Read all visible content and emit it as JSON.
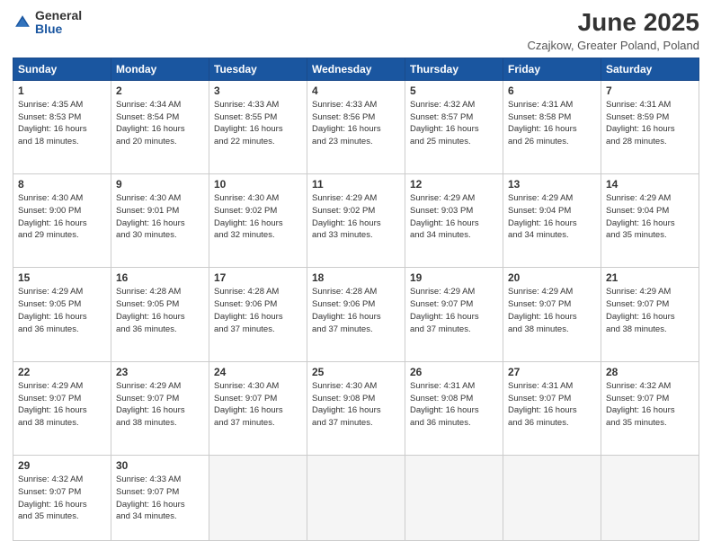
{
  "header": {
    "logo_general": "General",
    "logo_blue": "Blue",
    "month_title": "June 2025",
    "location": "Czajkow, Greater Poland, Poland"
  },
  "days_of_week": [
    "Sunday",
    "Monday",
    "Tuesday",
    "Wednesday",
    "Thursday",
    "Friday",
    "Saturday"
  ],
  "weeks": [
    [
      {
        "day": 1,
        "info": "Sunrise: 4:35 AM\nSunset: 8:53 PM\nDaylight: 16 hours\nand 18 minutes."
      },
      {
        "day": 2,
        "info": "Sunrise: 4:34 AM\nSunset: 8:54 PM\nDaylight: 16 hours\nand 20 minutes."
      },
      {
        "day": 3,
        "info": "Sunrise: 4:33 AM\nSunset: 8:55 PM\nDaylight: 16 hours\nand 22 minutes."
      },
      {
        "day": 4,
        "info": "Sunrise: 4:33 AM\nSunset: 8:56 PM\nDaylight: 16 hours\nand 23 minutes."
      },
      {
        "day": 5,
        "info": "Sunrise: 4:32 AM\nSunset: 8:57 PM\nDaylight: 16 hours\nand 25 minutes."
      },
      {
        "day": 6,
        "info": "Sunrise: 4:31 AM\nSunset: 8:58 PM\nDaylight: 16 hours\nand 26 minutes."
      },
      {
        "day": 7,
        "info": "Sunrise: 4:31 AM\nSunset: 8:59 PM\nDaylight: 16 hours\nand 28 minutes."
      }
    ],
    [
      {
        "day": 8,
        "info": "Sunrise: 4:30 AM\nSunset: 9:00 PM\nDaylight: 16 hours\nand 29 minutes."
      },
      {
        "day": 9,
        "info": "Sunrise: 4:30 AM\nSunset: 9:01 PM\nDaylight: 16 hours\nand 30 minutes."
      },
      {
        "day": 10,
        "info": "Sunrise: 4:30 AM\nSunset: 9:02 PM\nDaylight: 16 hours\nand 32 minutes."
      },
      {
        "day": 11,
        "info": "Sunrise: 4:29 AM\nSunset: 9:02 PM\nDaylight: 16 hours\nand 33 minutes."
      },
      {
        "day": 12,
        "info": "Sunrise: 4:29 AM\nSunset: 9:03 PM\nDaylight: 16 hours\nand 34 minutes."
      },
      {
        "day": 13,
        "info": "Sunrise: 4:29 AM\nSunset: 9:04 PM\nDaylight: 16 hours\nand 34 minutes."
      },
      {
        "day": 14,
        "info": "Sunrise: 4:29 AM\nSunset: 9:04 PM\nDaylight: 16 hours\nand 35 minutes."
      }
    ],
    [
      {
        "day": 15,
        "info": "Sunrise: 4:29 AM\nSunset: 9:05 PM\nDaylight: 16 hours\nand 36 minutes."
      },
      {
        "day": 16,
        "info": "Sunrise: 4:28 AM\nSunset: 9:05 PM\nDaylight: 16 hours\nand 36 minutes."
      },
      {
        "day": 17,
        "info": "Sunrise: 4:28 AM\nSunset: 9:06 PM\nDaylight: 16 hours\nand 37 minutes."
      },
      {
        "day": 18,
        "info": "Sunrise: 4:28 AM\nSunset: 9:06 PM\nDaylight: 16 hours\nand 37 minutes."
      },
      {
        "day": 19,
        "info": "Sunrise: 4:29 AM\nSunset: 9:07 PM\nDaylight: 16 hours\nand 37 minutes."
      },
      {
        "day": 20,
        "info": "Sunrise: 4:29 AM\nSunset: 9:07 PM\nDaylight: 16 hours\nand 38 minutes."
      },
      {
        "day": 21,
        "info": "Sunrise: 4:29 AM\nSunset: 9:07 PM\nDaylight: 16 hours\nand 38 minutes."
      }
    ],
    [
      {
        "day": 22,
        "info": "Sunrise: 4:29 AM\nSunset: 9:07 PM\nDaylight: 16 hours\nand 38 minutes."
      },
      {
        "day": 23,
        "info": "Sunrise: 4:29 AM\nSunset: 9:07 PM\nDaylight: 16 hours\nand 38 minutes."
      },
      {
        "day": 24,
        "info": "Sunrise: 4:30 AM\nSunset: 9:07 PM\nDaylight: 16 hours\nand 37 minutes."
      },
      {
        "day": 25,
        "info": "Sunrise: 4:30 AM\nSunset: 9:08 PM\nDaylight: 16 hours\nand 37 minutes."
      },
      {
        "day": 26,
        "info": "Sunrise: 4:31 AM\nSunset: 9:08 PM\nDaylight: 16 hours\nand 36 minutes."
      },
      {
        "day": 27,
        "info": "Sunrise: 4:31 AM\nSunset: 9:07 PM\nDaylight: 16 hours\nand 36 minutes."
      },
      {
        "day": 28,
        "info": "Sunrise: 4:32 AM\nSunset: 9:07 PM\nDaylight: 16 hours\nand 35 minutes."
      }
    ],
    [
      {
        "day": 29,
        "info": "Sunrise: 4:32 AM\nSunset: 9:07 PM\nDaylight: 16 hours\nand 35 minutes."
      },
      {
        "day": 30,
        "info": "Sunrise: 4:33 AM\nSunset: 9:07 PM\nDaylight: 16 hours\nand 34 minutes."
      },
      null,
      null,
      null,
      null,
      null
    ]
  ]
}
